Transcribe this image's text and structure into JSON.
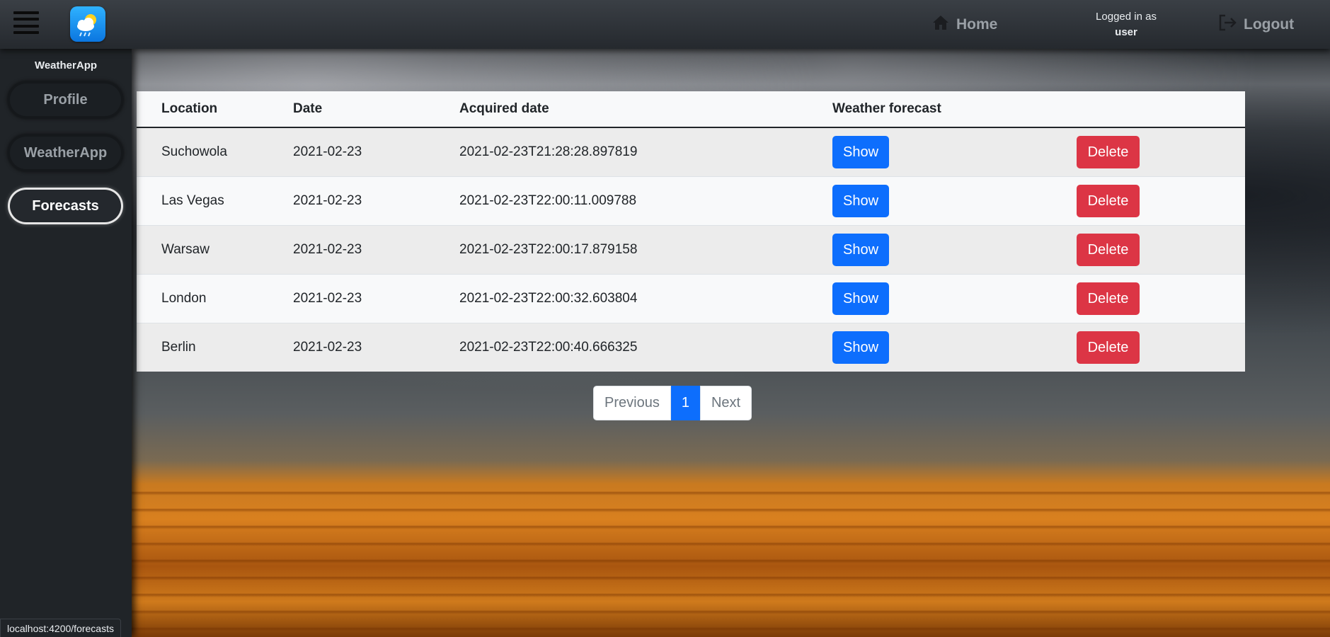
{
  "nav": {
    "home_label": "Home",
    "logged_in_label": "Logged in as",
    "username": "user",
    "logout_label": "Logout"
  },
  "sidebar": {
    "title": "WeatherApp",
    "items": [
      {
        "label": "Profile"
      },
      {
        "label": "WeatherApp"
      },
      {
        "label": "Forecasts"
      }
    ],
    "active": "Forecasts"
  },
  "table": {
    "headers": [
      "Location",
      "Date",
      "Acquired date",
      "Weather forecast",
      ""
    ],
    "rows": [
      {
        "location": "Suchowola",
        "date": "2021-02-23",
        "acquired": "2021-02-23T21:28:28.897819",
        "show": "Show",
        "delete": "Delete"
      },
      {
        "location": "Las Vegas",
        "date": "2021-02-23",
        "acquired": "2021-02-23T22:00:11.009788",
        "show": "Show",
        "delete": "Delete"
      },
      {
        "location": "Warsaw",
        "date": "2021-02-23",
        "acquired": "2021-02-23T22:00:17.879158",
        "show": "Show",
        "delete": "Delete"
      },
      {
        "location": "London",
        "date": "2021-02-23",
        "acquired": "2021-02-23T22:00:32.603804",
        "show": "Show",
        "delete": "Delete"
      },
      {
        "location": "Berlin",
        "date": "2021-02-23",
        "acquired": "2021-02-23T22:00:40.666325",
        "show": "Show",
        "delete": "Delete"
      }
    ]
  },
  "pagination": {
    "previous": "Previous",
    "current": "1",
    "next": "Next"
  },
  "status_bar": {
    "url": "localhost:4200/forecasts"
  },
  "colors": {
    "primary": "#0d6efd",
    "danger": "#dc3545",
    "sidebar_bg": "#202428"
  },
  "icons": [
    "menu-icon",
    "weather-app-logo-icon",
    "home-icon",
    "logout-icon"
  ]
}
